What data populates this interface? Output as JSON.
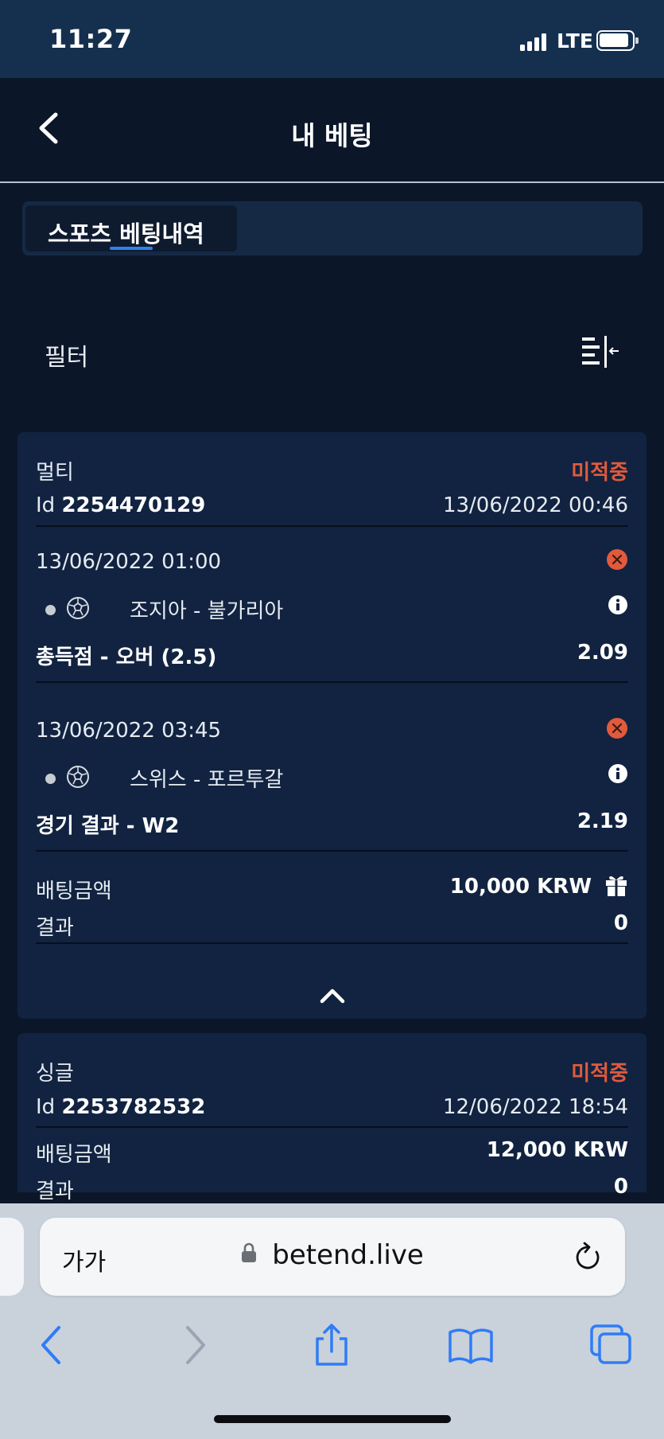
{
  "status_bar": {
    "time": "11:27",
    "network": "LTE",
    "battery_level": 0.85
  },
  "header": {
    "title": "내 베팅"
  },
  "tabs": [
    {
      "label": "스포츠 베팅내역",
      "active": true
    }
  ],
  "filter": {
    "label": "필터"
  },
  "bets": [
    {
      "type": "멀티",
      "status": "미적중",
      "id_label": "Id",
      "id": "2254470129",
      "datetime": "13/06/2022 00:46",
      "selections": [
        {
          "datetime": "13/06/2022 01:00",
          "match": "조지아 - 불가리아",
          "market": "총득점 - 오버 (2.5)",
          "odds": "2.09"
        },
        {
          "datetime": "13/06/2022 03:45",
          "match": "스위스 - 포르투갈",
          "market": "경기 결과 - W2",
          "odds": "2.19"
        }
      ],
      "stake_label": "배팅금액",
      "stake": "10,000 KRW",
      "result_label": "결과",
      "result": "0"
    },
    {
      "type": "싱글",
      "status": "미적중",
      "id_label": "Id",
      "id": "2253782532",
      "datetime": "12/06/2022 18:54",
      "stake_label": "배팅금액",
      "stake": "12,000 KRW",
      "result_label": "결과",
      "result": "0"
    }
  ],
  "browser": {
    "text_size_label": "가가",
    "url": "betend.live"
  },
  "colors": {
    "status_red": "#e15a3c",
    "accent_blue": "#2e82e8",
    "safari_blue": "#2f7cf6",
    "card_bg": "#112340",
    "page_bg": "#0b1729"
  }
}
